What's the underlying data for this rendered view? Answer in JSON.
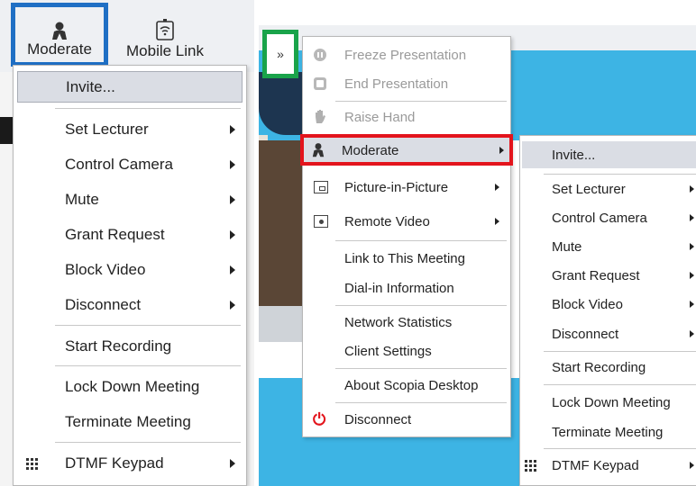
{
  "left_panel": {
    "toolbar": {
      "moderate_label": "Moderate",
      "mobile_link_label": "Mobile Link"
    },
    "menu": {
      "items": [
        {
          "label": "Invite...",
          "submenu": false,
          "highlighted": true
        },
        {
          "label": "Set Lecturer",
          "submenu": true
        },
        {
          "label": "Control Camera",
          "submenu": true
        },
        {
          "label": "Mute",
          "submenu": true
        },
        {
          "label": "Grant Request",
          "submenu": true
        },
        {
          "label": "Block Video",
          "submenu": true
        },
        {
          "label": "Disconnect",
          "submenu": true
        },
        {
          "label": "Start Recording",
          "submenu": false
        },
        {
          "label": "Lock Down Meeting",
          "submenu": false
        },
        {
          "label": "Terminate Meeting",
          "submenu": false
        },
        {
          "label": "DTMF Keypad",
          "submenu": true,
          "icon": "keypad-icon"
        }
      ]
    }
  },
  "right_panel": {
    "expand_button_label": "»",
    "menu": {
      "items": [
        {
          "label": "Freeze Presentation",
          "disabled": true,
          "icon": "pause-icon"
        },
        {
          "label": "End Presentation",
          "disabled": true,
          "icon": "stop-icon"
        },
        {
          "label": "Raise Hand",
          "disabled": true,
          "icon": "hand-icon"
        },
        {
          "label": "Moderate",
          "submenu": true,
          "highlighted": true,
          "icon": "person-icon"
        },
        {
          "label": "Picture-in-Picture",
          "submenu": true,
          "icon": "picture-in-picture-icon"
        },
        {
          "label": "Remote Video",
          "submenu": true,
          "icon": "remote-video-icon"
        },
        {
          "label": "Link to This Meeting"
        },
        {
          "label": "Dial-in Information"
        },
        {
          "label": "Network Statistics"
        },
        {
          "label": "Client Settings"
        },
        {
          "label": "About Scopia Desktop"
        },
        {
          "label": "Disconnect",
          "icon": "power-icon"
        }
      ]
    },
    "submenu": {
      "items": [
        {
          "label": "Invite...",
          "highlighted": true
        },
        {
          "label": "Set Lecturer",
          "submenu": true
        },
        {
          "label": "Control Camera",
          "submenu": true
        },
        {
          "label": "Mute",
          "submenu": true
        },
        {
          "label": "Grant Request",
          "submenu": true
        },
        {
          "label": "Block Video",
          "submenu": true
        },
        {
          "label": "Disconnect",
          "submenu": true
        },
        {
          "label": "Start Recording"
        },
        {
          "label": "Lock Down Meeting"
        },
        {
          "label": "Terminate Meeting"
        },
        {
          "label": "DTMF Keypad",
          "submenu": true,
          "icon": "keypad-icon"
        }
      ]
    }
  },
  "colors": {
    "moderate_highlight_border": "#1f6fc4",
    "expand_highlight_border": "#19a34a",
    "moderate_item_highlight_border": "#e3141c",
    "menu_hover_bg": "#dadde4",
    "video_blue": "#3db4e4",
    "disconnect_icon": "#e3141c"
  }
}
